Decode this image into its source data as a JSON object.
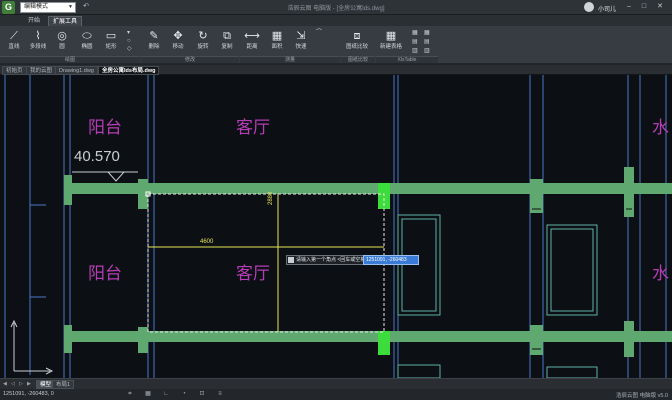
{
  "titlebar": {
    "logo": "G",
    "mode": "编辑模式",
    "window_title": "浩辰云图 电脑版 - [全房公寓Ids.dwg]",
    "user_name": "小司儿",
    "accent": "#3f7f3a"
  },
  "menu": {
    "tabs": [
      "开始",
      "扩展工具"
    ],
    "active": "扩展工具"
  },
  "ribbon": {
    "buttons": [
      {
        "icon": "line-icon",
        "glyph": "⟋",
        "label": "直线"
      },
      {
        "icon": "polyline-icon",
        "glyph": "⌇",
        "label": "多段线"
      },
      {
        "icon": "circle-icon",
        "glyph": "◎",
        "label": "圆"
      },
      {
        "icon": "ellipse-icon",
        "glyph": "⬭",
        "label": "椭圆"
      },
      {
        "icon": "rectangle-icon",
        "glyph": "▭",
        "label": "矩形"
      },
      {
        "icon": "delete-icon",
        "glyph": "✎",
        "label": "删除"
      },
      {
        "icon": "move-icon",
        "glyph": "✥",
        "label": "移动"
      },
      {
        "icon": "rotate-icon",
        "glyph": "↻",
        "label": "旋转"
      },
      {
        "icon": "copy-icon",
        "glyph": "⧉",
        "label": "复制"
      },
      {
        "icon": "distance-icon",
        "glyph": "⟷",
        "label": "距离"
      },
      {
        "icon": "area-icon",
        "glyph": "▦",
        "label": "面积"
      },
      {
        "icon": "quick-measure-icon",
        "glyph": "⇲",
        "label": "快速"
      },
      {
        "icon": "drawing-compare-icon",
        "glyph": "⧈",
        "label": "图纸比较"
      },
      {
        "icon": "new-table-icon",
        "glyph": "▦",
        "label": "新建表格"
      }
    ],
    "small_items": [
      "▾",
      "○",
      "◇",
      "⌒"
    ],
    "groups": [
      "绘图",
      "修改",
      "测量",
      "图纸比较",
      "XlsTable"
    ]
  },
  "doc_tabs": [
    "初始页",
    "我的云图",
    "Drawing1.dwg",
    "全房公寓Ids布局.dwg"
  ],
  "doc_active": 3,
  "canvas": {
    "room_labels": [
      "阳台",
      "客厅",
      "水",
      "阳台",
      "客厅",
      "水"
    ],
    "dimension_large": "40.570",
    "dim_width": "4600",
    "dim_height": "2880",
    "prompt": "请输入第一个角点 <回车或空格>:",
    "coord_input": "1251091, -260483",
    "wall_color": "#5fa86f",
    "highlight_color": "#3ddc3d",
    "text_color": "#b53db5"
  },
  "layout_tabs": [
    "模型",
    "布局1"
  ],
  "layout_active": 0,
  "status": {
    "coords": "1251091, -260483, 0",
    "right_text": "浩辰云图 电脑版 v5.0"
  }
}
